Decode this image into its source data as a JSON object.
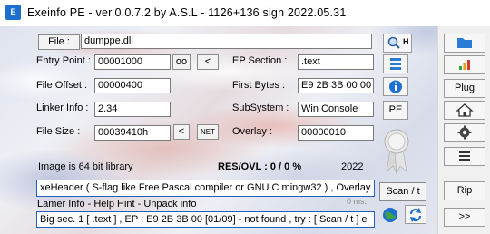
{
  "window": {
    "title": "Exeinfo PE - ver.0.0.7.2  by A.S.L -  1126+136 sign  2022.05.31"
  },
  "file": {
    "button_label": "File :",
    "value": "dumppe.dll"
  },
  "fields": {
    "entry_point": {
      "label": "Entry Point :",
      "value": "00001000",
      "oo_button": "oo",
      "prev_button": "<"
    },
    "ep_section": {
      "label": "EP Section :",
      "value": ".text"
    },
    "file_offset": {
      "label": "File Offset :",
      "value": "00000400"
    },
    "first_bytes": {
      "label": "First Bytes :",
      "value": "E9 2B 3B 00 00"
    },
    "linker_info": {
      "label": "Linker Info :",
      "value": "2.34"
    },
    "subsystem": {
      "label": "SubSystem :",
      "value": "Win Console"
    },
    "file_size": {
      "label": "File Size :",
      "value": "00039410h",
      "prev_button": "<",
      "net_button": "NET"
    },
    "overlay": {
      "label": "Overlay :",
      "value": "00000010"
    }
  },
  "tools": {
    "search_hotkey": "H",
    "pe_button": "PE"
  },
  "status": {
    "arch": "Image is 64 bit library",
    "res_ovl": "RES/OVL : 0 / 0 %",
    "year": "2022"
  },
  "result": {
    "main_text": "xeHeader ( S-flag like Free Pascal compiler or GNU C mingw32 ) , Overlay :",
    "timing": "0 ms.",
    "help_line": "Lamer Info - Help Hint - Unpack info",
    "hint_text": "Big sec. 1 [ .text ] , EP : E9 2B 3B 00 [01/09] - not found , try : [ Scan / t ] e",
    "scan_button": "Scan / t"
  },
  "side_buttons": {
    "plug": "Plug",
    "rip": "Rip",
    "next": ">>"
  },
  "colors": {
    "accent_blue": "#1f6fd1",
    "result_border": "#1e5fc2"
  }
}
